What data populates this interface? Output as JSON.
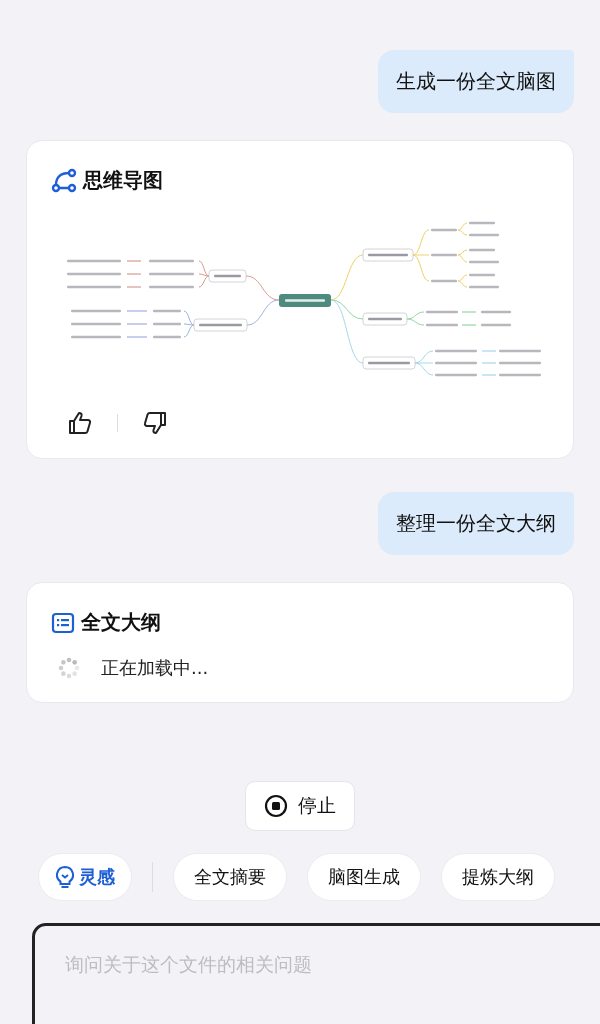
{
  "messages": [
    {
      "kind": "user",
      "text": "生成一份全文脑图"
    },
    {
      "kind": "mindmap",
      "title": "思维导图"
    },
    {
      "kind": "user",
      "text": "整理一份全文大纲"
    },
    {
      "kind": "loading",
      "title": "全文大纲",
      "status": "正在加载中..."
    }
  ],
  "stop_button": "停止",
  "chips": [
    {
      "kind": "inspire",
      "label": "灵感"
    },
    {
      "kind": "plain",
      "label": "全文摘要"
    },
    {
      "kind": "plain",
      "label": "脑图生成"
    },
    {
      "kind": "plain",
      "label": "提炼大纲"
    }
  ],
  "input": {
    "placeholder": "询问关于这个文件的相关问题"
  }
}
